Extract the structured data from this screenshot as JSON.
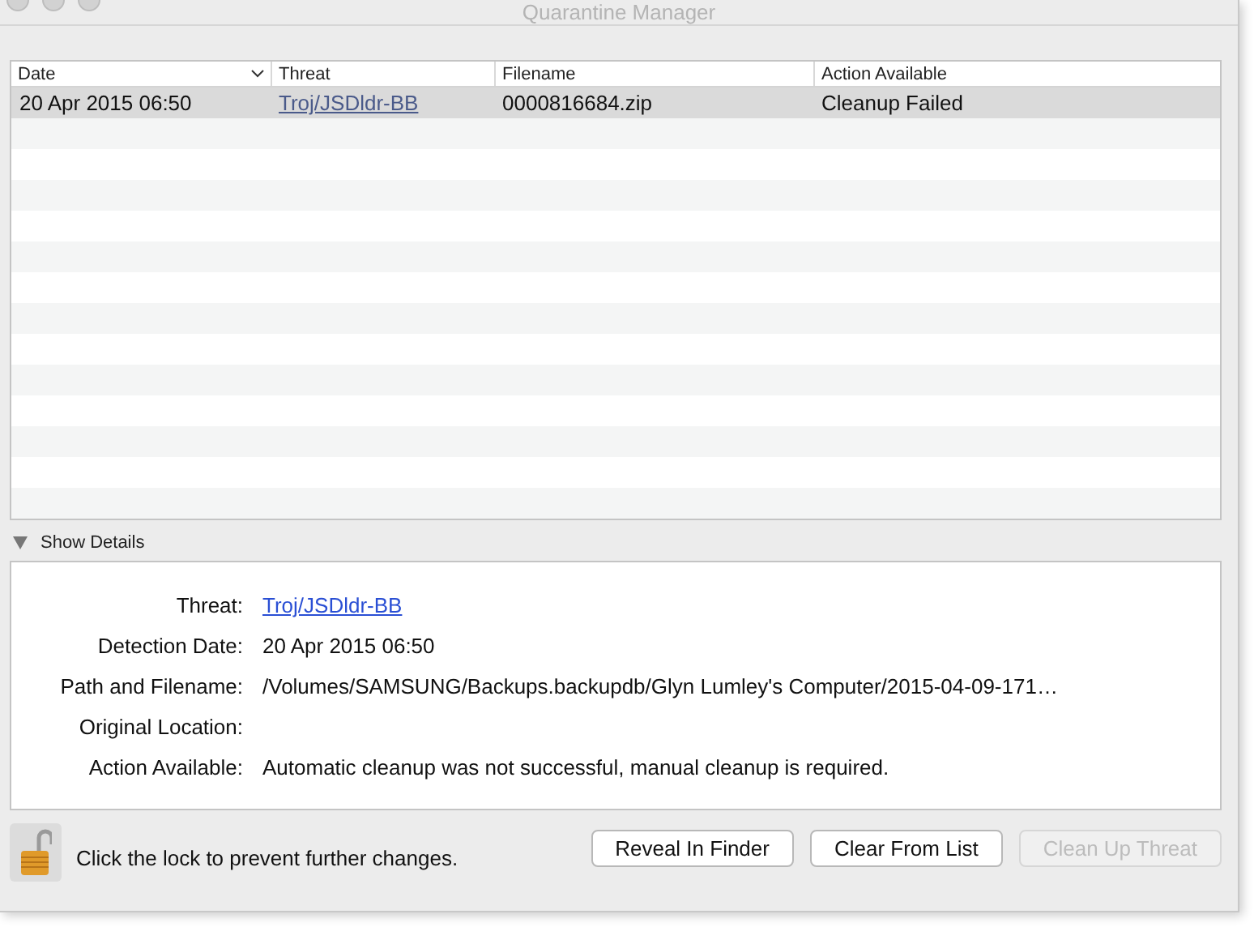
{
  "window": {
    "title": "Quarantine Manager"
  },
  "table": {
    "columns": [
      {
        "label": "Date",
        "sorted": true
      },
      {
        "label": "Threat",
        "sorted": false
      },
      {
        "label": "Filename",
        "sorted": false
      },
      {
        "label": "Action Available",
        "sorted": false
      }
    ],
    "rows": [
      {
        "selected": true,
        "cells": [
          "20 Apr 2015 06:50",
          "Troj/JSDldr-BB",
          "0000816684.zip",
          "Cleanup Failed"
        ]
      }
    ]
  },
  "details": {
    "toggle": "Show Details",
    "expanded": true,
    "fields": [
      {
        "label": "Threat:",
        "value": "Troj/JSDldr-BB",
        "kind": "link"
      },
      {
        "label": "Detection Date:",
        "value": "20 Apr 2015 06:50",
        "kind": "text"
      },
      {
        "label": "Path and Filename:",
        "value": "/Volumes/SAMSUNG/Backups.backupdb/Glyn Lumley's Computer/2015-04-09-171…",
        "kind": "text"
      },
      {
        "label": "Original Location:"
      },
      {
        "label": "Action Available:",
        "value": "Automatic cleanup was not successful, manual cleanup is required.",
        "kind": "text"
      }
    ]
  },
  "footer": {
    "lock_text": "Click the lock to prevent further changes.",
    "locked": false,
    "buttons": [
      {
        "label": "Reveal In Finder",
        "disabled": false
      },
      {
        "label": "Clear From List",
        "disabled": false
      },
      {
        "label": "Clean Up Threat",
        "disabled": true
      }
    ]
  }
}
